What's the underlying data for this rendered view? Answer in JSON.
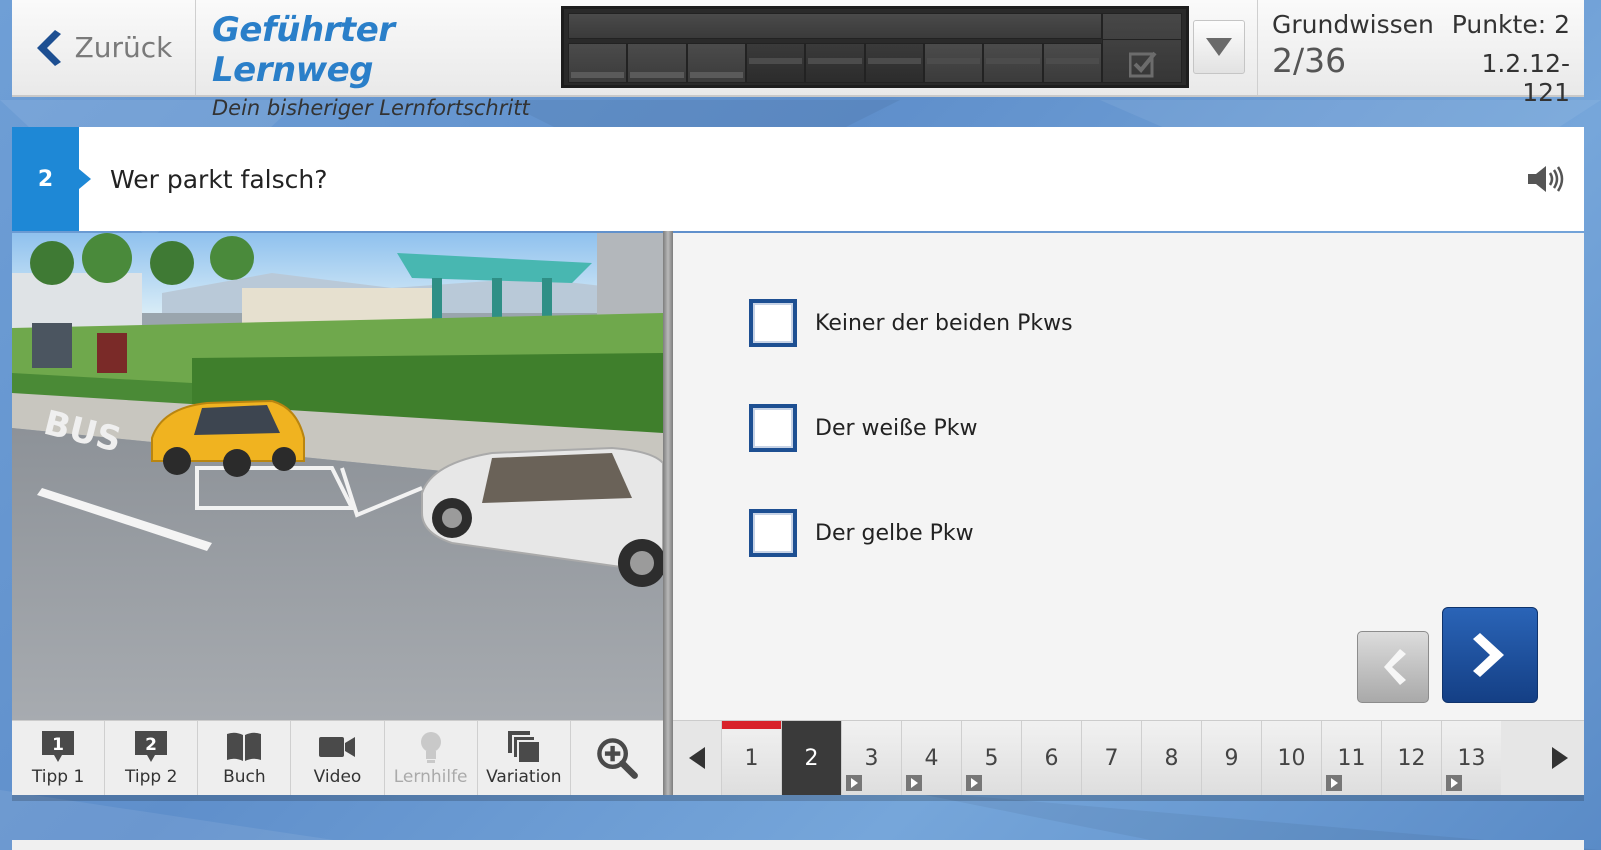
{
  "header": {
    "back_label": "Zurück",
    "title": "Geführter Lernweg",
    "subtitle": "Dein bisheriger Lernfortschritt",
    "category": "Grundwissen",
    "progress_count": "2/36",
    "points": "Punkte: 2",
    "question_code": "1.2.12-121"
  },
  "question": {
    "number": "2",
    "text": "Wer parkt falsch?"
  },
  "answers": [
    {
      "label": "Keiner der beiden Pkws",
      "checked": false
    },
    {
      "label": "Der weiße Pkw",
      "checked": false
    },
    {
      "label": "Der gelbe Pkw",
      "checked": false
    }
  ],
  "tools": [
    {
      "label": "Tipp 1",
      "icon": "tip-1-icon",
      "enabled": true
    },
    {
      "label": "Tipp 2",
      "icon": "tip-2-icon",
      "enabled": true
    },
    {
      "label": "Buch",
      "icon": "book-icon",
      "enabled": true
    },
    {
      "label": "Video",
      "icon": "video-camera-icon",
      "enabled": true
    },
    {
      "label": "Lernhilfe",
      "icon": "lightbulb-icon",
      "enabled": false
    },
    {
      "label": "Variation",
      "icon": "stacked-pages-icon",
      "enabled": true
    }
  ],
  "pager": {
    "pages": [
      "1",
      "2",
      "3",
      "4",
      "5",
      "6",
      "7",
      "8",
      "9",
      "10",
      "11",
      "12",
      "13"
    ],
    "active": "2",
    "answered": [
      "1"
    ],
    "video_pages": [
      "3",
      "4",
      "5",
      "11",
      "13"
    ]
  },
  "colors": {
    "accent_blue": "#1e88d6",
    "checkbox_border": "#1d4f92",
    "answered_marker": "#d8232a"
  }
}
